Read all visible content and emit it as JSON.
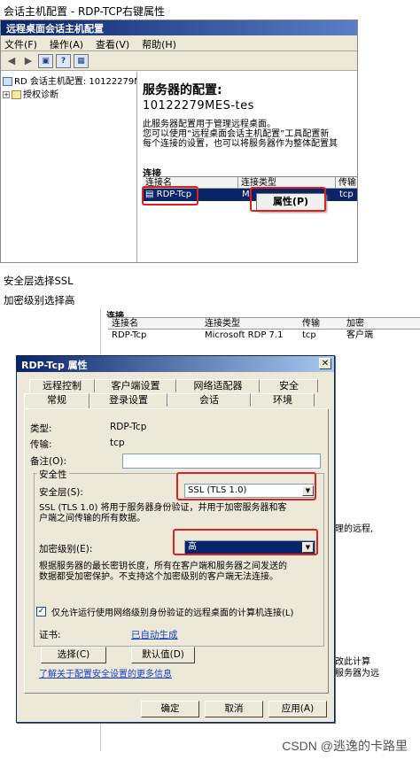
{
  "top_heading": "会话主机配置 - RDP-TCP右键属性",
  "window": {
    "title": "远程桌面会话主机配置",
    "menu": [
      "文件(F)",
      "操作(A)",
      "查看(V)",
      "帮助(H)"
    ],
    "toolbar_icons": [
      "back-arrow-icon",
      "forward-arrow-icon",
      "console-icon",
      "help-icon"
    ],
    "tree": {
      "root": "RD 会话主机配置: 10122279M",
      "child": "授权诊断"
    },
    "right": {
      "title": "服务器的配置:",
      "server": "10122279MES-tes",
      "desc1": "此服务器配置用于管理远程桌面。",
      "desc2": "您可以使用“远程桌面会话主机配置”工具配置新",
      "desc3": "每个连接的设置，也可以将服务器作为整体配置其",
      "section": "连接",
      "headers": [
        "连接名",
        "连接类型",
        "传输"
      ],
      "row": {
        "name": "RDP-Tcp",
        "type": "Mi",
        "transport": "tcp"
      }
    },
    "context_menu": "属性(P)"
  },
  "notes": {
    "line1": "安全层选择SSL",
    "line2": "加密级别选择高"
  },
  "background": {
    "section": "连接",
    "headers": [
      "连接名",
      "连接类型",
      "传输",
      "加密"
    ],
    "row": [
      "RDP-Tcp",
      "Microsoft RDP 7.1",
      "tcp",
      "客户端"
    ],
    "frag1": "理的远程,",
    "frag2": "改此计算",
    "frag3": "服务器为远"
  },
  "dialog": {
    "title": "RDP-Tcp 属性",
    "tabs_row1": [
      "远程控制",
      "客户端设置",
      "网络适配器",
      "安全"
    ],
    "tabs_row2": [
      "常规",
      "登录设置",
      "会话",
      "环境"
    ],
    "type_label": "类型:",
    "type_value": "RDP-Tcp",
    "transport_label": "传输:",
    "transport_value": "tcp",
    "comment_label": "备注(O):",
    "comment_value": "",
    "security_group": "安全性",
    "security_layer_label": "安全层(S):",
    "security_layer_value": "SSL (TLS 1.0)",
    "security_desc1": "SSL (TLS 1.0) 将用于服务器身份验证，并用于加密服务器和客",
    "security_desc2": "户端之间传输的所有数据。",
    "encryption_label": "加密级别(E):",
    "encryption_value": "高",
    "encryption_desc1": "根据服务器的最长密钥长度，所有在客户端和服务器之间发送的",
    "encryption_desc2": "数据都受加密保护。不支持这个加密级别的客户端无法连接。",
    "nla_checked": true,
    "nla_label": "仅允许运行使用网络级别身份验证的远程桌面的计算机连接(L)",
    "cert_label": "证书:",
    "cert_link": "已自动生成",
    "select_button": "选择(C)",
    "default_button": "默认值(D)",
    "more_link": "了解关于配置安全设置的更多信息",
    "ok": "确定",
    "cancel": "取消",
    "apply": "应用(A)"
  },
  "watermark": "CSDN @逃逸的卡路里"
}
